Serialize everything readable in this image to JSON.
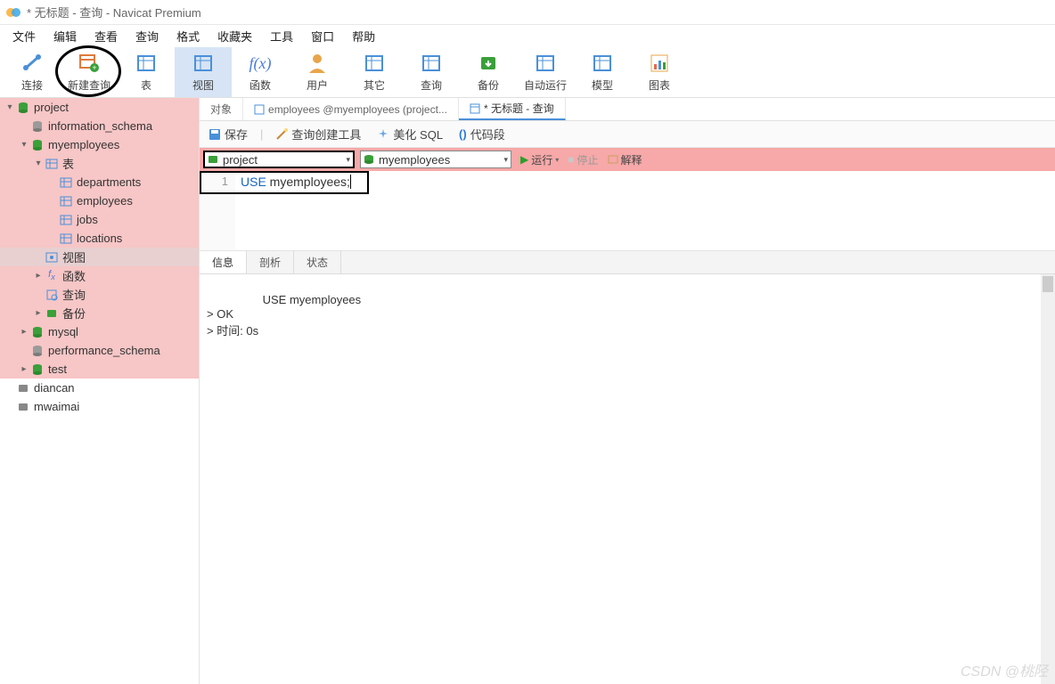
{
  "title": "* 无标题 - 查询 - Navicat Premium",
  "menu": [
    "文件",
    "编辑",
    "查看",
    "查询",
    "格式",
    "收藏夹",
    "工具",
    "窗口",
    "帮助"
  ],
  "toolbar": [
    {
      "id": "connect",
      "label": "连接",
      "color": "#4a90d9"
    },
    {
      "id": "newquery",
      "label": "新建查询",
      "color": "#e07a3c",
      "circled": true
    },
    {
      "id": "table",
      "label": "表",
      "color": "#4a90d9"
    },
    {
      "id": "view",
      "label": "视图",
      "color": "#4a90d9",
      "active": true
    },
    {
      "id": "function",
      "label": "函数",
      "color": "#4a7bd9",
      "glyph": "f(x)"
    },
    {
      "id": "user",
      "label": "用户",
      "color": "#e8a54a"
    },
    {
      "id": "other",
      "label": "其它",
      "color": "#4a90d9"
    },
    {
      "id": "query",
      "label": "查询",
      "color": "#4a90d9"
    },
    {
      "id": "backup",
      "label": "备份",
      "color": "#3aa03a"
    },
    {
      "id": "autorun",
      "label": "自动运行",
      "color": "#4a90d9"
    },
    {
      "id": "model",
      "label": "模型",
      "color": "#4a90d9"
    },
    {
      "id": "chart",
      "label": "图表",
      "color": "#e8a54a"
    }
  ],
  "tree": [
    {
      "indent": 0,
      "chev": "▾",
      "icon": "db-green",
      "label": "project",
      "hl": "pink"
    },
    {
      "indent": 1,
      "chev": "",
      "icon": "db-gray",
      "label": "information_schema",
      "hl": "pink"
    },
    {
      "indent": 1,
      "chev": "▾",
      "icon": "db-green",
      "label": "myemployees",
      "hl": "pink"
    },
    {
      "indent": 2,
      "chev": "▾",
      "icon": "table",
      "label": "表",
      "hl": "pink"
    },
    {
      "indent": 3,
      "chev": "",
      "icon": "table",
      "label": "departments",
      "hl": "pink"
    },
    {
      "indent": 3,
      "chev": "",
      "icon": "table",
      "label": "employees",
      "hl": "pink"
    },
    {
      "indent": 3,
      "chev": "",
      "icon": "table",
      "label": "jobs",
      "hl": "pink"
    },
    {
      "indent": 3,
      "chev": "",
      "icon": "table",
      "label": "locations",
      "hl": "pink"
    },
    {
      "indent": 2,
      "chev": "",
      "icon": "view",
      "label": "视图",
      "hl": "sel"
    },
    {
      "indent": 2,
      "chev": "▸",
      "icon": "fx",
      "label": "函数",
      "hl": "pink"
    },
    {
      "indent": 2,
      "chev": "",
      "icon": "query",
      "label": "查询",
      "hl": "pink"
    },
    {
      "indent": 2,
      "chev": "▸",
      "icon": "backup",
      "label": "备份",
      "hl": "pink"
    },
    {
      "indent": 1,
      "chev": "▸",
      "icon": "db-green",
      "label": "mysql",
      "hl": "pink"
    },
    {
      "indent": 1,
      "chev": "",
      "icon": "db-gray",
      "label": "performance_schema",
      "hl": "pink"
    },
    {
      "indent": 1,
      "chev": "▸",
      "icon": "db-green",
      "label": "test",
      "hl": "pink"
    },
    {
      "indent": 0,
      "chev": "",
      "icon": "conn-gray",
      "label": "diancan",
      "hl": ""
    },
    {
      "indent": 0,
      "chev": "",
      "icon": "conn-gray",
      "label": "mwaimai",
      "hl": ""
    }
  ],
  "tabs": [
    {
      "label": "对象",
      "icon": "",
      "active": false
    },
    {
      "label": "employees @myemployees (project...",
      "icon": "table",
      "active": false
    },
    {
      "label": "* 无标题 - 查询",
      "icon": "query",
      "active": true
    }
  ],
  "subtoolbar": {
    "save": "保存",
    "builder": "查询创建工具",
    "beautify": "美化 SQL",
    "snippet": "代码段"
  },
  "connbar": {
    "conn": "project",
    "db": "myemployees",
    "run": "运行",
    "stop": "停止",
    "explain": "解释"
  },
  "editor": {
    "line": "1",
    "kw": "USE",
    "rest": " myemployees;"
  },
  "result_tabs": [
    "信息",
    "剖析",
    "状态"
  ],
  "result_body": "USE myemployees\n> OK\n> 时间: 0s",
  "watermark": "CSDN @桃陉"
}
